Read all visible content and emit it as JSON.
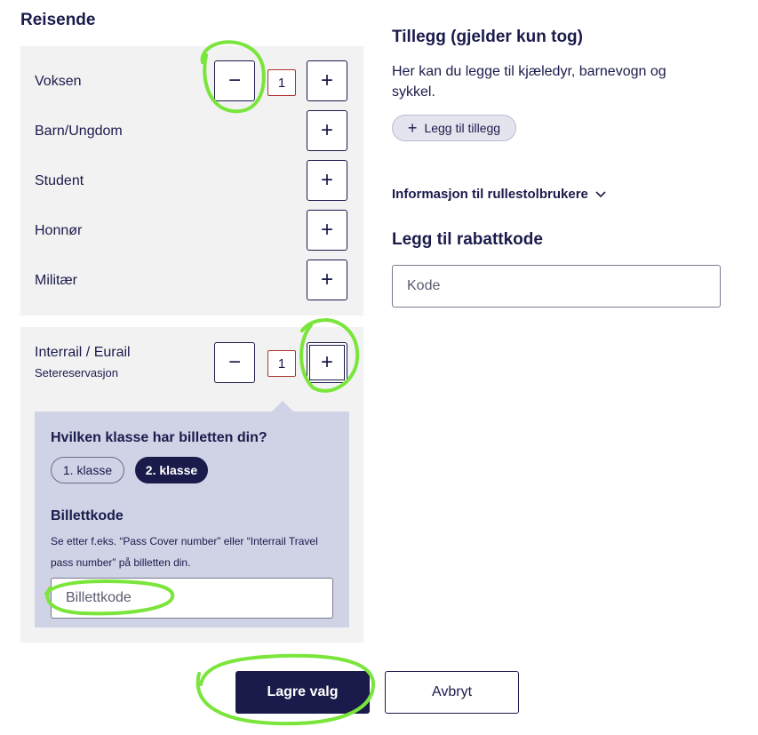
{
  "travelers": {
    "heading": "Reisende",
    "rows": [
      {
        "label": "Voksen",
        "count": "1"
      },
      {
        "label": "Barn/Ungdom"
      },
      {
        "label": "Student"
      },
      {
        "label": "Honnør"
      },
      {
        "label": "Militær"
      }
    ],
    "minus_symbol": "−",
    "plus_symbol": "+"
  },
  "interrail": {
    "title": "Interrail / Eurail",
    "subtitle": "Setereservasjon",
    "count": "1",
    "class_question": "Hvilken klasse har billetten din?",
    "classes": [
      {
        "label": "1. klasse",
        "selected": false
      },
      {
        "label": "2. klasse",
        "selected": true
      }
    ],
    "ticket_code_heading": "Billettkode",
    "ticket_code_help": "Se etter f.eks. “Pass Cover number” eller “Interrail Travel pass number” på billetten din.",
    "ticket_code_placeholder": "Billettkode"
  },
  "addons": {
    "heading": "Tillegg (gjelder kun tog)",
    "description": "Her kan du legge til kjæledyr, barnevogn og sykkel.",
    "add_button_label": "Legg til tillegg",
    "add_icon": "+"
  },
  "wheelchair_info": {
    "label": "Informasjon til rullestolbrukere",
    "icon": "chevron-down-icon"
  },
  "discount": {
    "heading": "Legg til rabattkode",
    "placeholder": "Kode"
  },
  "actions": {
    "save_label": "Lagre valg",
    "cancel_label": "Avbryt"
  },
  "colors": {
    "primary": "#1a1b4b",
    "count_border": "#b03030",
    "panel_bg": "#f2f2f2",
    "inner_panel_bg": "#d0d2e6",
    "annotation": "#7ae53a"
  }
}
